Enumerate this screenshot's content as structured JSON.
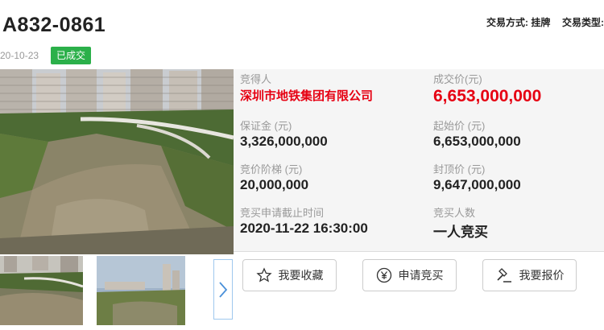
{
  "header": {
    "lot_code": "A832-0861",
    "trade_method": "交易方式: 挂牌",
    "trade_type": "交易类型:",
    "date": "20-10-23",
    "status_badge": "已成交"
  },
  "info": {
    "winner_label": "竞得人",
    "winner_value": "深圳市地铁集团有限公司",
    "deal_price_label": "成交价(元)",
    "deal_price_value": "6,653,000,000",
    "deposit_label": "保证金 (元)",
    "deposit_value": "3,326,000,000",
    "start_price_label": "起始价 (元)",
    "start_price_value": "6,653,000,000",
    "bid_step_label": "竞价阶梯 (元)",
    "bid_step_value": "20,000,000",
    "cap_price_label": "封顶价 (元)",
    "cap_price_value": "9,647,000,000",
    "deadline_label": "竞买申请截止时间",
    "deadline_value": "2020-11-22 16:30:00",
    "bidders_label": "竞买人数",
    "bidders_value": "一人竞买"
  },
  "actions": {
    "favorite_label": "我要收藏",
    "apply_label": "申请竞买",
    "quote_label": "我要报价"
  },
  "icons": {
    "favorite": "star-icon",
    "apply": "yen-icon",
    "quote": "gavel-icon",
    "next": "chevron-right-icon"
  },
  "colors": {
    "accent_red": "#e60012",
    "badge_green": "#2bb04a",
    "next_border": "#9fc8ee"
  }
}
